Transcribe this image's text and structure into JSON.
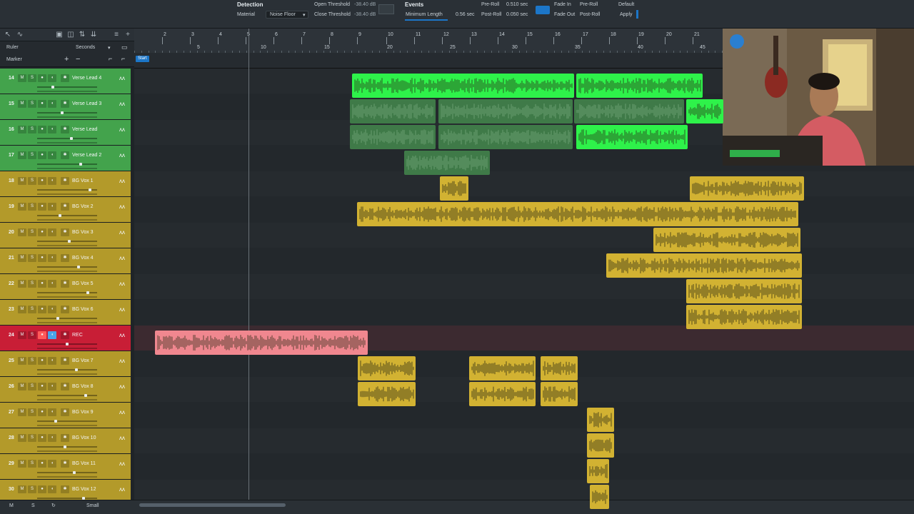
{
  "topbar": {
    "detection_label": "Detection",
    "material_label": "Material",
    "material_value": "Noise Floor",
    "open_threshold_label": "Open Threshold",
    "open_threshold_value": "-38.40 dB",
    "close_threshold_label": "Close Threshold",
    "close_threshold_value": "-38.40 dB",
    "events_label": "Events",
    "min_length_label": "Minimum Length",
    "min_length_value": "0.56 sec",
    "preroll_label": "Pre-Roll",
    "preroll_value": "0.510 sec",
    "postroll_label": "Post-Roll",
    "postroll_value": "0.050 sec",
    "fade_in_label": "Fade In",
    "fade_out_label": "Fade Out",
    "fade_in_value": "Pre-Roll",
    "fade_out_value": "Post-Roll",
    "default_label": "Default",
    "apply_label": "Apply"
  },
  "header": {
    "ruler_label": "Ruler",
    "ruler_mode": "Seconds",
    "marker_label": "Marker",
    "start_marker": "Start"
  },
  "ruler": {
    "bars": [
      "2",
      "3",
      "4",
      "5",
      "6",
      "7",
      "8",
      "9",
      "10",
      "11",
      "12",
      "13",
      "14",
      "15",
      "16",
      "17",
      "18",
      "19",
      "20",
      "21"
    ],
    "seconds": [
      "5",
      "10",
      "15",
      "20",
      "25",
      "30",
      "35",
      "40",
      "45"
    ]
  },
  "tracks": [
    {
      "num": "14",
      "name": "Verse Lead 4",
      "color": "green"
    },
    {
      "num": "15",
      "name": "Verse Lead 3",
      "color": "green"
    },
    {
      "num": "16",
      "name": "Verse Lead",
      "color": "green"
    },
    {
      "num": "17",
      "name": "Verse Lead 2",
      "color": "green"
    },
    {
      "num": "18",
      "name": "BG Vox 1",
      "color": "gold"
    },
    {
      "num": "19",
      "name": "BG Vox 2",
      "color": "gold"
    },
    {
      "num": "20",
      "name": "BG Vox 3",
      "color": "gold"
    },
    {
      "num": "21",
      "name": "BG Vox 4",
      "color": "gold"
    },
    {
      "num": "22",
      "name": "BG Vox 5",
      "color": "gold"
    },
    {
      "num": "23",
      "name": "BG Vox 6",
      "color": "gold"
    },
    {
      "num": "24",
      "name": "REC",
      "color": "red"
    },
    {
      "num": "25",
      "name": "BG Vox 7",
      "color": "gold"
    },
    {
      "num": "26",
      "name": "BG Vox 8",
      "color": "gold"
    },
    {
      "num": "27",
      "name": "BG Vox 9",
      "color": "gold"
    },
    {
      "num": "28",
      "name": "BG Vox 10",
      "color": "gold"
    },
    {
      "num": "29",
      "name": "BG Vox 11",
      "color": "gold"
    },
    {
      "num": "30",
      "name": "BG Vox 12",
      "color": "gold"
    }
  ],
  "track_buttons": {
    "mute": "M",
    "solo": "S"
  },
  "bottom": {
    "mix_label": "M",
    "solo_label": "S",
    "size_label": "Small"
  },
  "colors": {
    "green_bright": "#2ef24a",
    "green_dim": "#3f7a48",
    "gold": "#d2b232",
    "rec_clip": "#f0878f",
    "accent": "#1c76c8"
  },
  "icons": [
    "arrow-tool-icon",
    "pencil-tool-icon",
    "add-track-icon",
    "webcam-feed"
  ]
}
